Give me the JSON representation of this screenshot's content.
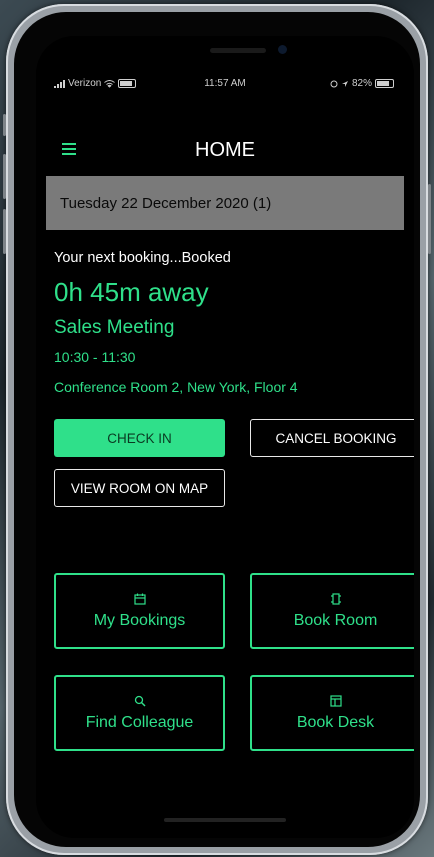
{
  "status_bar": {
    "carrier": "Verizon",
    "time": "11:57 AM",
    "battery": "82%"
  },
  "header": {
    "title": "HOME"
  },
  "date_bar": {
    "text": "Tuesday 22 December 2020 (1)"
  },
  "booking": {
    "label": "Your next booking...Booked",
    "away": "0h 45m away",
    "title": "Sales Meeting",
    "time": "10:30 - 11:30",
    "location": "Conference Room 2, New York, Floor 4"
  },
  "actions": {
    "check_in": "CHECK IN",
    "cancel": "CANCEL BOOKING",
    "view_map": "VIEW ROOM ON MAP"
  },
  "tiles": [
    {
      "label": "My Bookings",
      "icon": "calendar-icon"
    },
    {
      "label": "Book Room",
      "icon": "room-icon"
    },
    {
      "label": "Find Colleague",
      "icon": "search-icon"
    },
    {
      "label": "Book Desk",
      "icon": "desk-icon"
    }
  ],
  "colors": {
    "accent": "#2fe08a",
    "background": "#000000",
    "date_bar": "#7a7a7a"
  }
}
